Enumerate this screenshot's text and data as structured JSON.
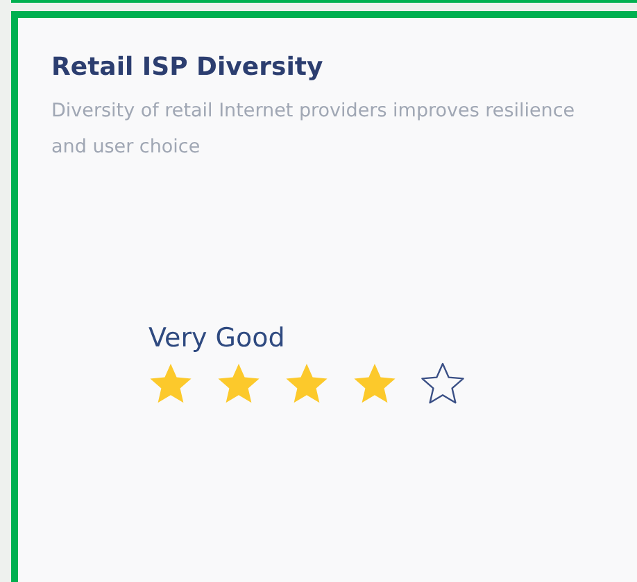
{
  "card": {
    "title": "Retail ISP Diversity",
    "description": "Diversity of retail Internet providers improves resilience and user choice"
  },
  "rating": {
    "label": "Very Good",
    "stars": 4
  }
}
